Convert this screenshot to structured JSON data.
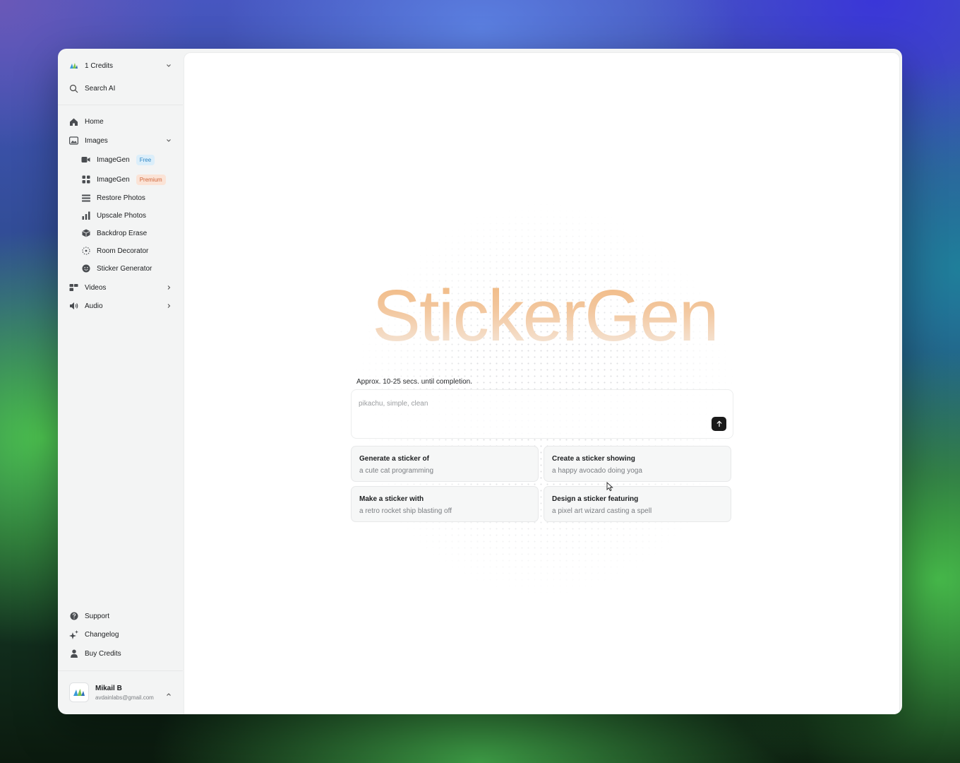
{
  "sidebar": {
    "credits_label": "1 Credits",
    "search_label": "Search AI",
    "nav": {
      "home": "Home",
      "images": "Images",
      "imagegen_free": "ImageGen",
      "free_badge": "Free",
      "imagegen_premium": "ImageGen",
      "premium_badge": "Premium",
      "restore": "Restore Photos",
      "upscale": "Upscale Photos",
      "backdrop": "Backdrop Erase",
      "room": "Room Decorator",
      "sticker": "Sticker Generator",
      "videos": "Videos",
      "audio": "Audio"
    },
    "footer": {
      "support": "Support",
      "changelog": "Changelog",
      "buy": "Buy Credits"
    },
    "user": {
      "name": "Mikail B",
      "email": "avdainlabs@gmail.com"
    }
  },
  "main": {
    "hero_title": "StickerGen",
    "eta": "Approx. 10-25 secs. until completion.",
    "prompt_placeholder": "pikachu, simple, clean",
    "suggestions": [
      {
        "title": "Generate a sticker of",
        "subtitle": "a cute cat programming"
      },
      {
        "title": "Create a sticker showing",
        "subtitle": "a happy avocado doing yoga"
      },
      {
        "title": "Make a sticker with",
        "subtitle": "a retro rocket ship blasting off"
      },
      {
        "title": "Design a sticker featuring",
        "subtitle": "a pixel art wizard casting a spell"
      }
    ]
  },
  "colors": {
    "accent_free": "#2f86c4",
    "accent_premium": "#d0663a",
    "hero_gradient_top": "#f0b67c"
  },
  "icons": [
    "logo-icon",
    "chevron-down-icon",
    "search-icon",
    "home-icon",
    "image-icon",
    "video-camera-icon",
    "grid-icon",
    "list-icon",
    "bar-chart-icon",
    "cube-icon",
    "room-dashed-icon",
    "smiley-icon",
    "video-layout-icon",
    "speaker-icon",
    "chevron-right-icon",
    "help-icon",
    "sparkle-icon",
    "user-icon",
    "chevron-up-icon",
    "arrow-up-icon"
  ]
}
